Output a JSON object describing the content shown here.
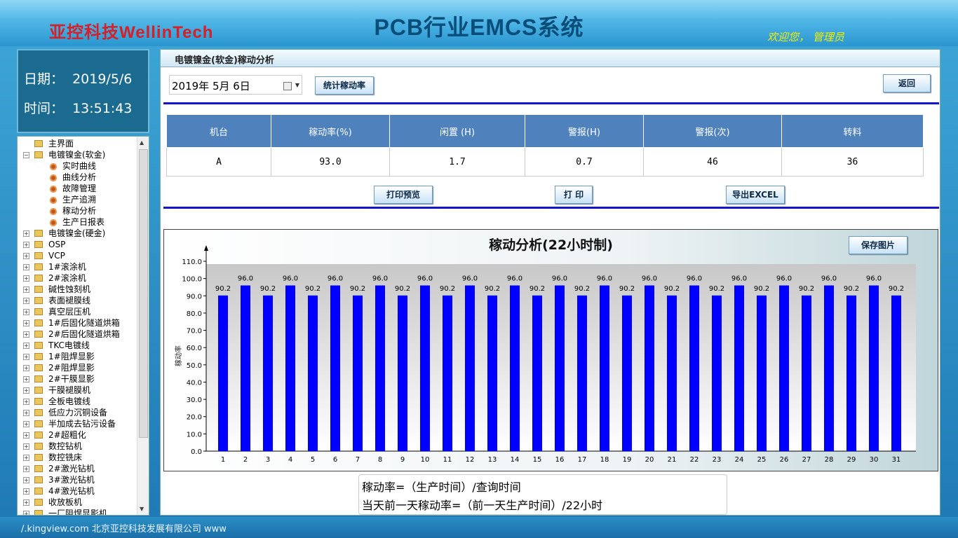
{
  "header": {
    "logo_cn": "亚控科技",
    "logo_en": "WellinTech",
    "title": "PCB行业EMCS系统",
    "welcome": "欢迎您， 管理员"
  },
  "datetime": {
    "date_label": "日期：",
    "date_value": "2019/5/6",
    "time_label": "时间：",
    "time_value": "13:51:43"
  },
  "tree": {
    "items": [
      {
        "label": "主界面",
        "level": 0,
        "expander": ""
      },
      {
        "label": "电镀镍金(软金)",
        "level": 0,
        "expander": "−"
      },
      {
        "label": "实时曲线",
        "level": 1
      },
      {
        "label": "曲线分析",
        "level": 1
      },
      {
        "label": "故障管理",
        "level": 1
      },
      {
        "label": "生产追溯",
        "level": 1
      },
      {
        "label": "稼动分析",
        "level": 1
      },
      {
        "label": "生产日报表",
        "level": 1
      },
      {
        "label": "电镀镍金(硬金)",
        "level": 0,
        "expander": "+"
      },
      {
        "label": "OSP",
        "level": 0,
        "expander": "+"
      },
      {
        "label": "VCP",
        "level": 0,
        "expander": "+"
      },
      {
        "label": "1#滚涂机",
        "level": 0,
        "expander": "+"
      },
      {
        "label": "2#滚涂机",
        "level": 0,
        "expander": "+"
      },
      {
        "label": "碱性蚀刻机",
        "level": 0,
        "expander": "+"
      },
      {
        "label": "表面褪膜线",
        "level": 0,
        "expander": "+"
      },
      {
        "label": "真空层压机",
        "level": 0,
        "expander": "+"
      },
      {
        "label": "1#后固化隧道烘箱",
        "level": 0,
        "expander": "+"
      },
      {
        "label": "2#后固化隧道烘箱",
        "level": 0,
        "expander": "+"
      },
      {
        "label": "TKC电镀线",
        "level": 0,
        "expander": "+"
      },
      {
        "label": "1#阻焊显影",
        "level": 0,
        "expander": "+"
      },
      {
        "label": "2#阻焊显影",
        "level": 0,
        "expander": "+"
      },
      {
        "label": "2#干膜显影",
        "level": 0,
        "expander": "+"
      },
      {
        "label": "干膜褪膜机",
        "level": 0,
        "expander": "+"
      },
      {
        "label": "全板电镀线",
        "level": 0,
        "expander": "+"
      },
      {
        "label": "低应力沉铜设备",
        "level": 0,
        "expander": "+"
      },
      {
        "label": "半加成去钻污设备",
        "level": 0,
        "expander": "+"
      },
      {
        "label": "2#超粗化",
        "level": 0,
        "expander": "+"
      },
      {
        "label": "数控钻机",
        "level": 0,
        "expander": "+"
      },
      {
        "label": "数控铣床",
        "level": 0,
        "expander": "+"
      },
      {
        "label": "2#激光钻机",
        "level": 0,
        "expander": "+"
      },
      {
        "label": "3#激光钻机",
        "level": 0,
        "expander": "+"
      },
      {
        "label": "4#激光钻机",
        "level": 0,
        "expander": "+"
      },
      {
        "label": "收放板机",
        "level": 0,
        "expander": "+"
      },
      {
        "label": "一厂阻焊显影机",
        "level": 0,
        "expander": "+"
      }
    ]
  },
  "panel": {
    "title": "电镀镍金(软金)稼动分析",
    "date_value": "2019年  5月  6日",
    "stat_button": "统计稼动率",
    "back_button": "返回",
    "print_preview_button": "打印预览",
    "print_button": "打 印",
    "export_button": "导出EXCEL",
    "save_image_button": "保存图片"
  },
  "table": {
    "headers": [
      "机台",
      "稼动率(%)",
      "闲置 (H)",
      "警报(H)",
      "警报(次)",
      "转料"
    ],
    "rows": [
      [
        "A",
        "93.0",
        "1.7",
        "0.7",
        "46",
        "36"
      ]
    ]
  },
  "chart_data": {
    "type": "bar",
    "title": "稼动分析(22小时制)",
    "ylabel": "稼动率",
    "xlabel": "",
    "ylim": [
      0,
      110
    ],
    "yticks": [
      "0.0",
      "10.0",
      "20.0",
      "30.0",
      "40.0",
      "50.0",
      "60.0",
      "70.0",
      "80.0",
      "90.0",
      "100.0",
      "110.0"
    ],
    "categories": [
      "1",
      "2",
      "3",
      "4",
      "5",
      "6",
      "7",
      "8",
      "9",
      "10",
      "11",
      "12",
      "13",
      "14",
      "15",
      "16",
      "17",
      "18",
      "19",
      "20",
      "21",
      "22",
      "23",
      "24",
      "25",
      "26",
      "27",
      "28",
      "29",
      "30",
      "31"
    ],
    "values": [
      90.2,
      96.0,
      90.2,
      96.0,
      90.2,
      96.0,
      90.2,
      96.0,
      90.2,
      96.0,
      90.2,
      96.0,
      90.2,
      96.0,
      90.2,
      96.0,
      90.2,
      96.0,
      90.2,
      96.0,
      90.2,
      96.0,
      90.2,
      96.0,
      90.2,
      96.0,
      90.2,
      96.0,
      90.2,
      96.0,
      90.2
    ],
    "labels": [
      "90.2",
      "96.0",
      "90.2",
      "96.0",
      "90.2",
      "96.0",
      "90.2",
      "96.0",
      "90.2",
      "96.0",
      "90.2",
      "96.0",
      "90.2",
      "96.0",
      "90.2",
      "96.0",
      "90.2",
      "96.0",
      "90.2",
      "96.0",
      "90.2",
      "96.0",
      "90.2",
      "96.0",
      "90.2",
      "96.0",
      "90.2",
      "96.0",
      "90.2",
      "96.0",
      "90.2"
    ],
    "bar_color": "#0000ff",
    "grid": false
  },
  "formula": {
    "line1": "稼动率=（生产时间）/查询时间",
    "line2": "当天前一天稼动率=（前一天生产时间）/22小时"
  },
  "footer": {
    "text": "/.kingview.com 北京亚控科技发展有限公司 www"
  }
}
